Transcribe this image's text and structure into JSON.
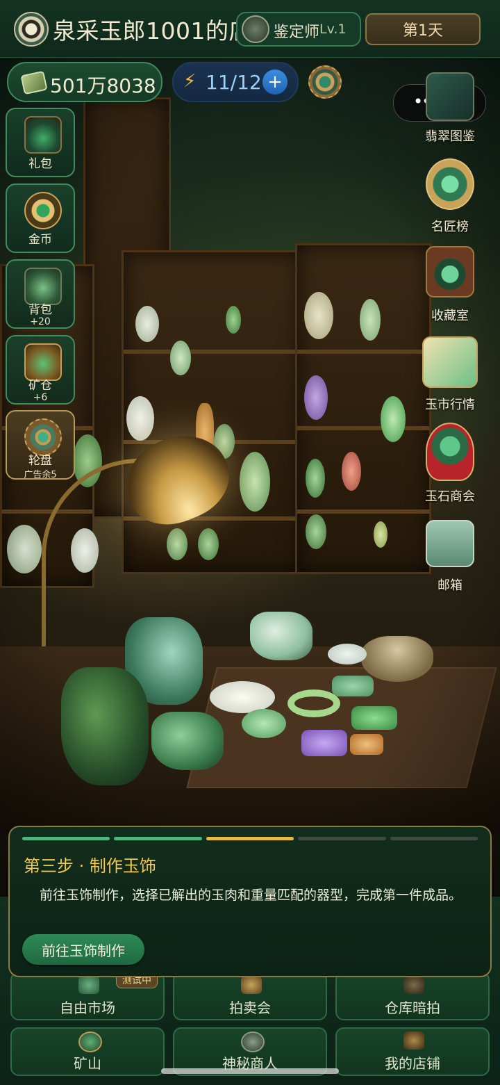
{
  "header": {
    "shop_title": "泉采玉郎1001的店",
    "role": "鉴定师",
    "level": "Lv.1",
    "day": "第1天"
  },
  "resources": {
    "money": "501万8038",
    "energy": "11/12",
    "energy_plus": "+",
    "energy_bolt": "⚡"
  },
  "capsule": {
    "dots": "•••"
  },
  "left_menu": [
    {
      "label": "礼包",
      "sub": ""
    },
    {
      "label": "金币",
      "sub": ""
    },
    {
      "label": "背包",
      "sub": "+20"
    },
    {
      "label": "矿仓",
      "sub": "+6"
    },
    {
      "label": "轮盘",
      "sub": "广告余5"
    }
  ],
  "right_menu": [
    {
      "label": "翡翠图鉴"
    },
    {
      "label": "名匠榜"
    },
    {
      "label": "收藏室"
    },
    {
      "label": "玉市行情"
    },
    {
      "label": "玉石商会"
    },
    {
      "label": "邮箱"
    }
  ],
  "guide": {
    "title": "第三步 · 制作玉饰",
    "body": "前往玉饰制作，选择已解出的玉肉和重量匹配的器型，完成第一件成品。",
    "button": "前往玉饰制作",
    "step_colors": [
      "#4fb57a",
      "#4fb57a",
      "#e4b94a",
      "#3e4d44",
      "#3e4d44"
    ]
  },
  "bottom_grid": [
    {
      "label": "自由市场",
      "badge": "测试中"
    },
    {
      "label": "拍卖会",
      "badge": ""
    },
    {
      "label": "仓库暗拍",
      "badge": ""
    },
    {
      "label": "矿山",
      "badge": ""
    },
    {
      "label": "神秘商人",
      "badge": ""
    },
    {
      "label": "我的店铺",
      "badge": ""
    }
  ],
  "colors": {
    "accent_green": "#3f8e5e",
    "gold": "#f2c94c",
    "progress_done": "#4fb57a",
    "progress_current": "#e4b94a"
  }
}
